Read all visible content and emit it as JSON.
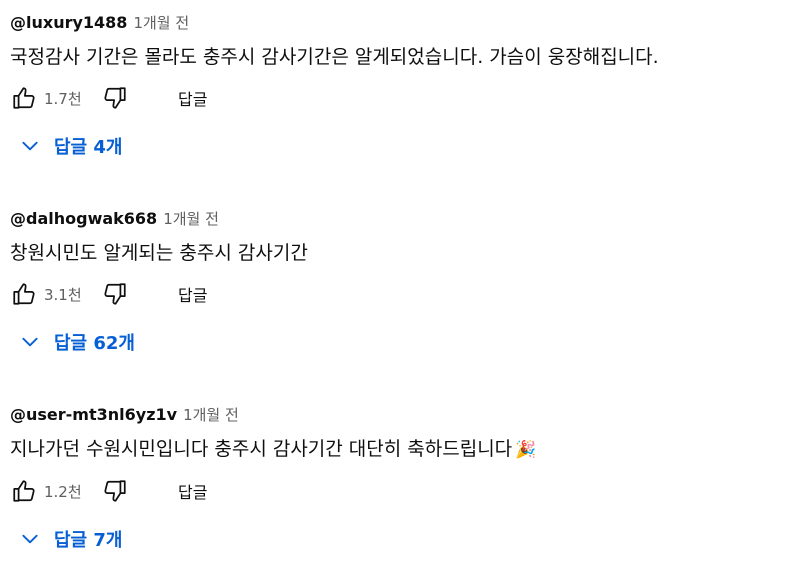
{
  "comments": [
    {
      "author": "@luxury1488",
      "time": "1개월 전",
      "text": "국정감사 기간은 몰라도 충주시 감사기간은 알게되었습니다. 가슴이 웅장해집니다.",
      "emoji": "",
      "likes": "1.7천",
      "reply_label": "답글",
      "replies_label": "답글 4개"
    },
    {
      "author": "@dalhogwak668",
      "time": "1개월 전",
      "text": "창원시민도 알게되는 충주시 감사기간",
      "emoji": "",
      "likes": "3.1천",
      "reply_label": "답글",
      "replies_label": "답글 62개"
    },
    {
      "author": "@user-mt3nl6yz1v",
      "time": "1개월 전",
      "text": "지나가던 수원시민입니다 충주시 감사기간 대단히 축하드립니다",
      "emoji": "🎉",
      "likes": "1.2천",
      "reply_label": "답글",
      "replies_label": "답글 7개"
    }
  ],
  "icons": {
    "like": "thumb-up-icon",
    "dislike": "thumb-down-icon",
    "expand": "chevron-down-icon"
  },
  "colors": {
    "text": "#0f0f0f",
    "secondary": "#606060",
    "link": "#065fd4"
  }
}
